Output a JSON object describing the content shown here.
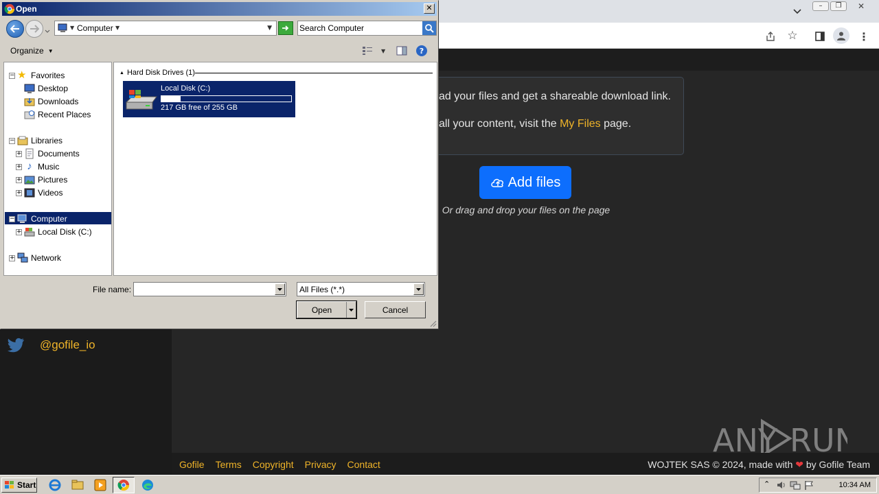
{
  "dialog": {
    "title": "Open",
    "location": "Computer",
    "search_placeholder": "Search Computer",
    "organize_label": "Organize",
    "tree": {
      "favorites": "Favorites",
      "desktop": "Desktop",
      "downloads": "Downloads",
      "recent_places": "Recent Places",
      "libraries": "Libraries",
      "documents": "Documents",
      "music": "Music",
      "pictures": "Pictures",
      "videos": "Videos",
      "computer": "Computer",
      "local_disk": "Local Disk (C:)",
      "network": "Network"
    },
    "group_header": "Hard Disk Drives (1)",
    "drive": {
      "name": "Local Disk (C:)",
      "free_text": "217 GB free of 255 GB",
      "used_fraction": 0.15
    },
    "file_name_label": "File name:",
    "file_name_value": "",
    "filter_value": "All Files (*.*)",
    "open_label": "Open",
    "cancel_label": "Cancel"
  },
  "page": {
    "info_line1": "ad your files and get a shareable download link.",
    "info_line2_prefix": "all your content, visit the",
    "info_line2_link": "My Files",
    "info_line2_suffix": "page.",
    "add_files_label": "Add files",
    "drag_text": "Or drag and drop your files on the page",
    "twitter_handle": "@gofile_io",
    "footer_links": [
      "Gofile",
      "Terms",
      "Copyright",
      "Privacy",
      "Contact"
    ],
    "footer_right_prefix": "WOJTEK SAS © 2024, made with",
    "footer_right_suffix": "by Gofile Team",
    "watermark": "ANY  RUN"
  },
  "taskbar": {
    "start_label": "Start",
    "clock": "10:34 AM"
  },
  "colors": {
    "accent_blue": "#0d6efd",
    "link_yellow": "#f0b429",
    "selection": "#0a246a"
  }
}
